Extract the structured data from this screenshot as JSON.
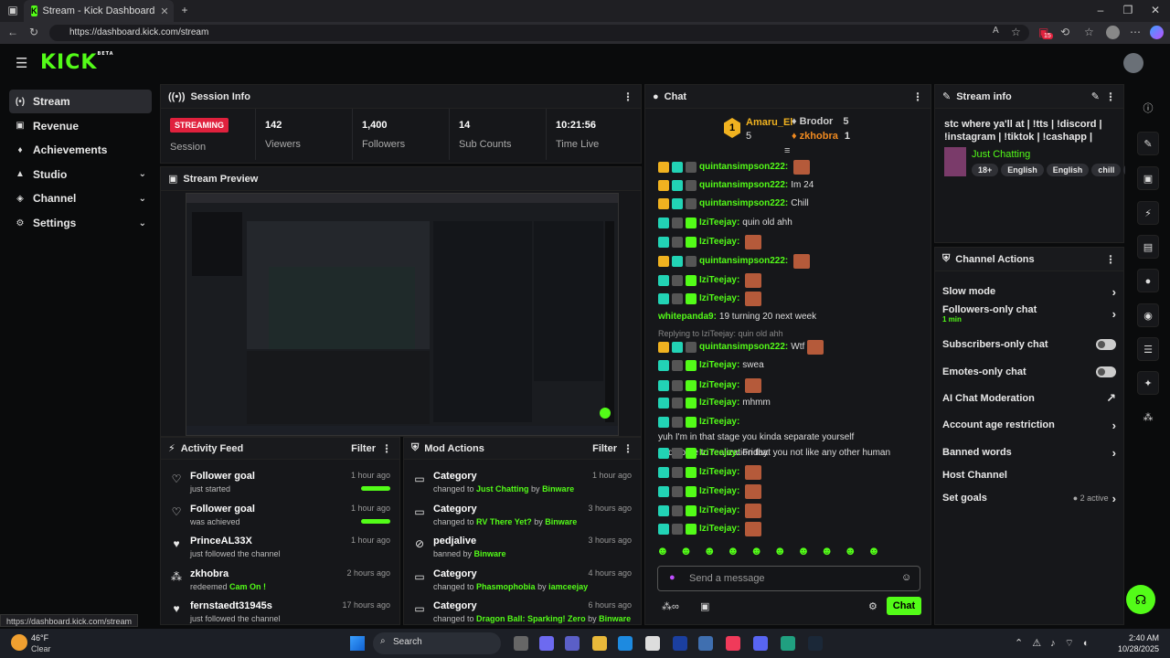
{
  "browser": {
    "tab_title": "Stream - Kick Dashboard",
    "url": "https://dashboard.kick.com/stream",
    "status_url": "https://dashboard.kick.com/stream",
    "new_tab": "+",
    "close_tab": "✕",
    "ext_badge": "15"
  },
  "app": {
    "logo": "KICK",
    "logo_tag": "BETA"
  },
  "sidebar": [
    {
      "icon": "(•)",
      "label": "Stream"
    },
    {
      "icon": "▣",
      "label": "Revenue"
    },
    {
      "icon": "♦",
      "label": "Achievements"
    },
    {
      "icon": "▲",
      "label": "Studio",
      "chev": "⌄"
    },
    {
      "icon": "◈",
      "label": "Channel",
      "chev": "⌄"
    },
    {
      "icon": "⚙",
      "label": "Settings",
      "chev": "⌄"
    }
  ],
  "session": {
    "title": "Session Info",
    "badge": "STREAMING",
    "label": "Session",
    "stats": [
      {
        "n": "142",
        "l": "Viewers"
      },
      {
        "n": "1,400",
        "l": "Followers"
      },
      {
        "n": "14",
        "l": "Sub Counts"
      },
      {
        "n": "10:21:56",
        "l": "Time Live"
      }
    ]
  },
  "preview": {
    "title": "Stream Preview"
  },
  "activity": {
    "title": "Activity Feed",
    "filter": "Filter",
    "items": [
      {
        "icon": "♡",
        "t": "Follower goal",
        "s": "just started",
        "ago": "1 hour ago",
        "bar": true
      },
      {
        "icon": "♡",
        "t": "Follower goal",
        "s": "was achieved",
        "ago": "1 hour ago",
        "bar": true
      },
      {
        "icon": "♥",
        "t": "PrinceAL33X",
        "s": "just followed the channel",
        "ago": "1 hour ago"
      },
      {
        "icon": "⁂",
        "t": "zkhobra",
        "s": "redeemed ",
        "g": "Cam On !",
        "ago": "2 hours ago"
      },
      {
        "icon": "♥",
        "t": "fernstaedt31945s",
        "s": "just followed the channel",
        "ago": "17 hours ago"
      }
    ]
  },
  "mod": {
    "title": "Mod Actions",
    "filter": "Filter",
    "items": [
      {
        "icon": "▭",
        "t": "Category",
        "s": "changed to ",
        "g": "Just Chatting",
        "by": " by ",
        "u": "Binware",
        "ago": "1 hour ago"
      },
      {
        "icon": "▭",
        "t": "Category",
        "s": "changed to ",
        "g": "RV There Yet?",
        "by": " by ",
        "u": "Binware",
        "ago": "3 hours ago"
      },
      {
        "icon": "⊘",
        "t": "pedjalive",
        "s": "banned by ",
        "g": "Binware",
        "by": "",
        "u": "",
        "ago": "3 hours ago"
      },
      {
        "icon": "▭",
        "t": "Category",
        "s": "changed to ",
        "g": "Phasmophobia",
        "by": " by ",
        "u": "iamceejay",
        "ago": "4 hours ago"
      },
      {
        "icon": "▭",
        "t": "Category",
        "s": "changed to ",
        "g": "Dragon Ball: Sparking! Zero",
        "by": " by ",
        "u": "Binware",
        "ago": "6 hours ago"
      }
    ]
  },
  "chat": {
    "title": "Chat",
    "top": [
      {
        "rank": "1",
        "name": "Amaru_El",
        "count": "5"
      },
      {
        "name": "Brodor",
        "count": "5"
      },
      {
        "name": "zkhobra",
        "count": "1"
      }
    ],
    "reply_note": "Replying to IziTeejay: quin old ahh",
    "lines": [
      {
        "b": [
          "y",
          "c",
          "k"
        ],
        "u": "quintansimpson222:",
        "m": "",
        "e": true
      },
      {
        "b": [
          "y",
          "c",
          "k"
        ],
        "u": "quintansimpson222:",
        "m": "Im 24"
      },
      {
        "b": [
          "y",
          "c",
          "k"
        ],
        "u": "quintansimpson222:",
        "m": "Chill"
      },
      {
        "b": [
          "c",
          "k",
          "g"
        ],
        "u": "IziTeejay:",
        "m": "quin old ahh"
      },
      {
        "b": [
          "c",
          "k",
          "g"
        ],
        "u": "IziTeejay:",
        "m": "",
        "e": true
      },
      {
        "b": [
          "y",
          "c",
          "k"
        ],
        "u": "quintansimpson222:",
        "m": "",
        "e": true
      },
      {
        "b": [
          "c",
          "k",
          "g"
        ],
        "u": "IziTeejay:",
        "m": "",
        "e": true
      },
      {
        "b": [
          "c",
          "k",
          "g"
        ],
        "u": "IziTeejay:",
        "m": "",
        "e": true
      },
      {
        "b": [],
        "u": "whitepanda9:",
        "m": "19 turning 20 next week"
      },
      {
        "b": [
          "y",
          "c",
          "k"
        ],
        "u": "quintansimpson222:",
        "m": "Wtf",
        "e": true
      },
      {
        "b": [
          "c",
          "k",
          "g"
        ],
        "u": "IziTeejay:",
        "m": "swea"
      },
      {
        "b": [
          "c",
          "k",
          "g"
        ],
        "u": "IziTeejay:",
        "m": "",
        "e": true
      },
      {
        "b": [
          "c",
          "k",
          "g"
        ],
        "u": "IziTeejay:",
        "m": "mhmm"
      },
      {
        "b": [
          "c",
          "k",
          "g"
        ],
        "u": "IziTeejay:",
        "m": "yuh I'm in that stage you kinda separate yourself",
        "m2": "and come to realization that you not like any other human"
      },
      {
        "b": [
          "c",
          "k",
          "g"
        ],
        "u": "IziTeejay:",
        "m": "Friday"
      },
      {
        "b": [
          "c",
          "k",
          "g"
        ],
        "u": "IziTeejay:",
        "m": "",
        "e": true
      },
      {
        "b": [
          "c",
          "k",
          "g"
        ],
        "u": "IziTeejay:",
        "m": "",
        "e": true
      },
      {
        "b": [
          "c",
          "k",
          "g"
        ],
        "u": "IziTeejay:",
        "m": "",
        "e": true
      },
      {
        "b": [
          "c",
          "k",
          "g"
        ],
        "u": "IziTeejay:",
        "m": "",
        "e": true
      }
    ],
    "placeholder": "Send a message",
    "send": "Chat"
  },
  "streaminfo": {
    "title": "Stream info",
    "text": "stc where ya'll at | !tts | !discord | !instagram | !tiktok | !cashapp |",
    "category": "Just Chatting",
    "tags": [
      "18+",
      "English",
      "English",
      "chill",
      "fu"
    ]
  },
  "actions": {
    "title": "Channel Actions",
    "items": [
      {
        "l": "Slow mode",
        "r": "›"
      },
      {
        "l": "Followers-only chat",
        "sub": "1 min",
        "r": "›"
      },
      {
        "l": "Subscribers-only chat",
        "tog": true
      },
      {
        "l": "Emotes-only chat",
        "tog": true
      },
      {
        "l": "AI Chat Moderation",
        "r": "↗"
      },
      {
        "l": "Account age restriction",
        "r": "›"
      },
      {
        "l": "Banned words",
        "r": "›"
      },
      {
        "l": "Host Channel",
        "r": ""
      },
      {
        "l": "Set goals",
        "extra": "● 2 active",
        "r": "›"
      }
    ]
  },
  "taskbar": {
    "temp": "46°F",
    "weather": "Clear",
    "search": "Search",
    "time": "2:40 AM",
    "date": "10/28/2025"
  },
  "colors": {
    "accent": "#53fc18",
    "live": "#e0213d"
  }
}
